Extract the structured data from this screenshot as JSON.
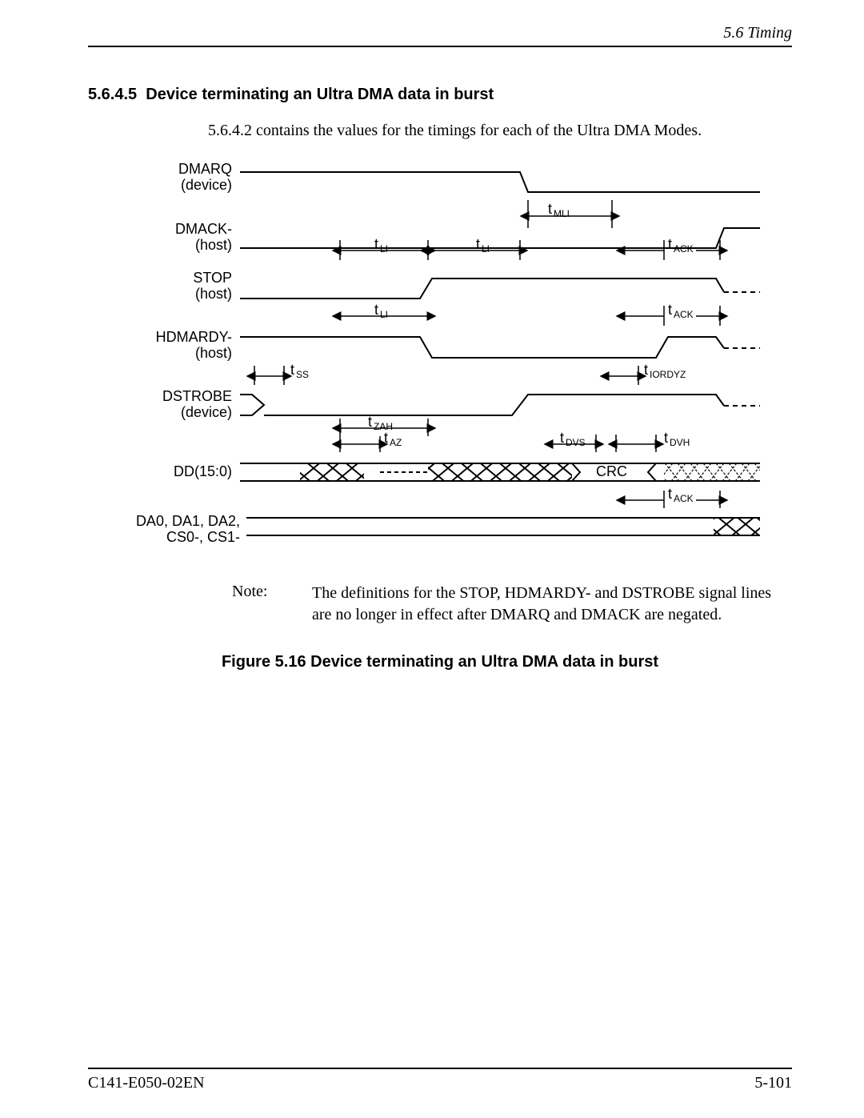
{
  "header": {
    "section_ref": "5.6  Timing"
  },
  "section": {
    "number": "5.6.4.5",
    "title": "Device terminating an Ultra DMA data in burst"
  },
  "intro_text": "5.6.4.2 contains the values for the timings for each of the Ultra DMA Modes.",
  "diagram": {
    "signals": {
      "dmarq": {
        "label": "DMARQ",
        "sub": "(device)"
      },
      "dmack": {
        "label": "DMACK-",
        "sub": "(host)"
      },
      "stop": {
        "label": "STOP",
        "sub": "(host)"
      },
      "hdmardy": {
        "label": "HDMARDY-",
        "sub": "(host)"
      },
      "dstrobe": {
        "label": "DSTROBE",
        "sub": "(device)"
      },
      "dd": {
        "label": "DD(15:0)"
      },
      "da": {
        "label": "DA0, DA1, DA2,",
        "sub": "CS0-, CS1-"
      }
    },
    "timings": {
      "t_mli": "MLI",
      "t_li": "LI",
      "t_ack": "ACK",
      "t_ss": "SS",
      "t_iordyz": "IORDYZ",
      "t_zah": "ZAH",
      "t_az": "AZ",
      "t_dvs": "DVS",
      "t_dvh": "DVH"
    },
    "crc_label": "CRC"
  },
  "note": {
    "label": "Note:",
    "body": "The definitions for the STOP, HDMARDY- and DSTROBE signal lines are no longer in effect after DMARQ and DMACK are negated."
  },
  "figure": {
    "caption": "Figure 5.16  Device terminating an Ultra DMA data in burst"
  },
  "footer": {
    "doc_id": "C141-E050-02EN",
    "page_num": "5-101"
  }
}
